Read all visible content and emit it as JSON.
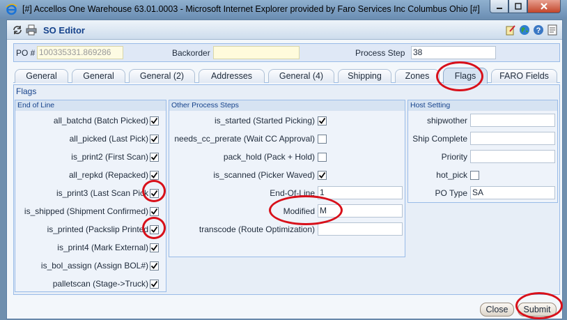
{
  "browser": {
    "title": "[#] Accellos One Warehouse 63.01.0003 - Microsoft Internet Explorer provided by Faro Services Inc Columbus Ohio [#]"
  },
  "dialog": {
    "title": "SO Editor"
  },
  "header": {
    "po_label": "PO #",
    "po_value": "100335331.869286",
    "backorder_label": "Backorder",
    "backorder_value": "",
    "process_step_label": "Process Step",
    "process_step_value": "38"
  },
  "tabs": [
    "General",
    "General",
    "General (2)",
    "Addresses",
    "General (4)",
    "Shipping",
    "Zones",
    "Flags",
    "FARO Fields"
  ],
  "active_tab": "Flags",
  "flags": {
    "panel_title": "Flags",
    "end_of_line": {
      "title": "End of Line",
      "items": [
        {
          "label": "all_batchd (Batch Picked)",
          "checked": true
        },
        {
          "label": "all_picked (Last Pick)",
          "checked": true
        },
        {
          "label": "is_print2 (First Scan)",
          "checked": true
        },
        {
          "label": "all_repkd (Repacked)",
          "checked": true
        },
        {
          "label": "is_print3 (Last Scan Pick",
          "checked": true
        },
        {
          "label": "is_shipped (Shipment Confirmed)",
          "checked": true
        },
        {
          "label": "is_printed (Packslip Printed",
          "checked": true
        },
        {
          "label": "is_print4 (Mark External)",
          "checked": true
        },
        {
          "label": "is_bol_assign (Assign BOL#)",
          "checked": true
        },
        {
          "label": "palletscan (Stage->Truck)",
          "checked": true
        }
      ]
    },
    "other_steps": {
      "title": "Other Process Steps",
      "checks": [
        {
          "label": "is_started (Started Picking)",
          "checked": true
        },
        {
          "label": "needs_cc_prerate (Wait CC Approval)",
          "checked": false
        },
        {
          "label": "pack_hold (Pack + Hold)",
          "checked": false
        },
        {
          "label": "is_scanned (Picker Waved)",
          "checked": true
        }
      ],
      "fields": [
        {
          "label": "End-Of-Line",
          "value": "1"
        },
        {
          "label": "Modified",
          "value": "M"
        },
        {
          "label": "transcode (Route Optimization)",
          "value": ""
        }
      ]
    },
    "host_setting": {
      "title": "Host Setting",
      "shipwother_label": "shipwother",
      "shipwother_value": "",
      "ship_complete_label": "Ship Complete",
      "ship_complete_value": "",
      "priority_label": "Priority",
      "priority_value": "",
      "hot_pick_label": "hot_pick",
      "hot_pick_checked": false,
      "po_type_label": "PO Type",
      "po_type_value": "SA"
    }
  },
  "buttons": {
    "close": "Close",
    "submit": "Submit"
  },
  "colors": {
    "annotation_red": "#d8101a",
    "accent": "#15428b"
  }
}
